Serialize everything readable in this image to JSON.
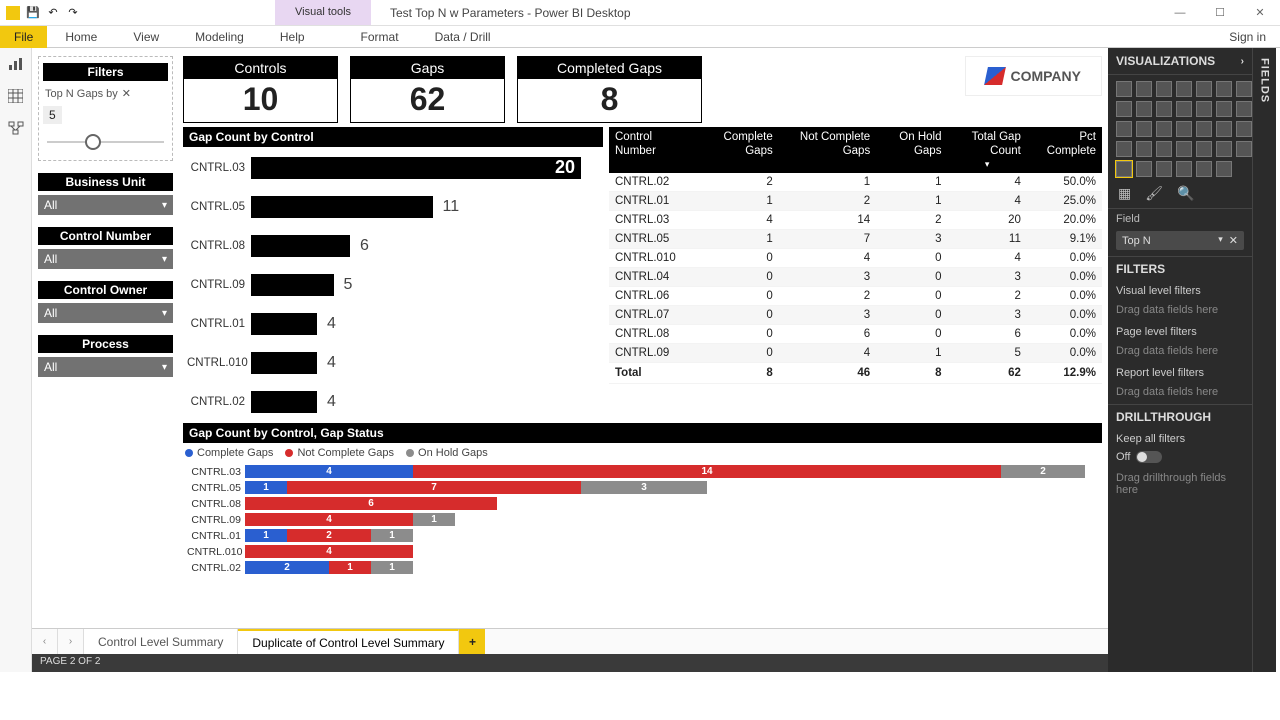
{
  "titlebar": {
    "visual_tools": "Visual tools",
    "title": "Test Top N w Parameters - Power BI Desktop"
  },
  "window_buttons": {
    "min": "—",
    "max": "☐",
    "close": "✕"
  },
  "ribbon": {
    "file": "File",
    "tabs": [
      "Home",
      "View",
      "Modeling",
      "Help",
      "Format",
      "Data / Drill"
    ],
    "signin": "Sign in"
  },
  "viewrail": {
    "report": "▮",
    "data": "▦",
    "model": "⌬"
  },
  "left_panel": {
    "filters_header": "Filters",
    "topn_label": "Top N Gaps by",
    "topn_x": "✕",
    "topn_value": "5",
    "business_unit": {
      "title": "Business Unit",
      "value": "All"
    },
    "control_number": {
      "title": "Control Number",
      "value": "All"
    },
    "control_owner": {
      "title": "Control Owner",
      "value": "All"
    },
    "process": {
      "title": "Process",
      "value": "All"
    }
  },
  "kpis": {
    "controls": {
      "label": "Controls",
      "value": "10"
    },
    "gaps": {
      "label": "Gaps",
      "value": "62"
    },
    "completed": {
      "label": "Completed Gaps",
      "value": "8"
    }
  },
  "logo_text": "COMPANY",
  "barchart_title": "Gap Count by Control",
  "table_headers": [
    "Control Number",
    "Complete Gaps",
    "Not Complete Gaps",
    "On Hold Gaps",
    "Total Gap Count",
    "Pct Complete"
  ],
  "table_rows": [
    {
      "c": "CNTRL.02",
      "v": [
        "2",
        "1",
        "1",
        "4",
        "50.0%"
      ]
    },
    {
      "c": "CNTRL.01",
      "v": [
        "1",
        "2",
        "1",
        "4",
        "25.0%"
      ]
    },
    {
      "c": "CNTRL.03",
      "v": [
        "4",
        "14",
        "2",
        "20",
        "20.0%"
      ]
    },
    {
      "c": "CNTRL.05",
      "v": [
        "1",
        "7",
        "3",
        "11",
        "9.1%"
      ]
    },
    {
      "c": "CNTRL.010",
      "v": [
        "0",
        "4",
        "0",
        "4",
        "0.0%"
      ]
    },
    {
      "c": "CNTRL.04",
      "v": [
        "0",
        "3",
        "0",
        "3",
        "0.0%"
      ]
    },
    {
      "c": "CNTRL.06",
      "v": [
        "0",
        "2",
        "0",
        "2",
        "0.0%"
      ]
    },
    {
      "c": "CNTRL.07",
      "v": [
        "0",
        "3",
        "0",
        "3",
        "0.0%"
      ]
    },
    {
      "c": "CNTRL.08",
      "v": [
        "0",
        "6",
        "0",
        "6",
        "0.0%"
      ]
    },
    {
      "c": "CNTRL.09",
      "v": [
        "0",
        "4",
        "1",
        "5",
        "0.0%"
      ]
    }
  ],
  "table_total": {
    "label": "Total",
    "v": [
      "8",
      "46",
      "8",
      "62",
      "12.9%"
    ]
  },
  "stack_title": "Gap Count by Control, Gap Status",
  "legend": {
    "a": "Complete Gaps",
    "b": "Not Complete Gaps",
    "c": "On Hold Gaps"
  },
  "tabs": {
    "prev": "‹",
    "next": "›",
    "t1": "Control Level Summary",
    "t2": "Duplicate of Control Level Summary",
    "add": "+"
  },
  "status": "PAGE 2 OF 2",
  "vis_pane": {
    "title": "VISUALIZATIONS",
    "field_label": "Field",
    "field_chip": "Top N",
    "filters_title": "FILTERS",
    "vlf": "Visual level filters",
    "plf": "Page level filters",
    "rlf": "Report level filters",
    "drag": "Drag data fields here",
    "drill_title": "DRILLTHROUGH",
    "keep": "Keep all filters",
    "off": "Off",
    "drill_drag": "Drag drillthrough fields here"
  },
  "fields_rail": "FIELDS",
  "chart_data": [
    {
      "type": "bar",
      "title": "Gap Count by Control",
      "orientation": "horizontal",
      "categories": [
        "CNTRL.03",
        "CNTRL.05",
        "CNTRL.08",
        "CNTRL.09",
        "CNTRL.01",
        "CNTRL.010",
        "CNTRL.02"
      ],
      "values": [
        20,
        11,
        6,
        5,
        4,
        4,
        4
      ],
      "xlim": [
        0,
        20
      ]
    },
    {
      "type": "bar_stacked",
      "title": "Gap Count by Control, Gap Status",
      "orientation": "horizontal",
      "categories": [
        "CNTRL.03",
        "CNTRL.05",
        "CNTRL.08",
        "CNTRL.09",
        "CNTRL.01",
        "CNTRL.010",
        "CNTRL.02"
      ],
      "series": [
        {
          "name": "Complete Gaps",
          "color": "#2a5fd0",
          "values": [
            4,
            1,
            0,
            0,
            1,
            0,
            2
          ]
        },
        {
          "name": "Not Complete Gaps",
          "color": "#d62c2c",
          "values": [
            14,
            7,
            6,
            4,
            2,
            4,
            1
          ]
        },
        {
          "name": "On Hold Gaps",
          "color": "#8c8c8c",
          "values": [
            2,
            3,
            0,
            1,
            1,
            0,
            1
          ]
        }
      ],
      "xlim": [
        0,
        20
      ]
    }
  ]
}
